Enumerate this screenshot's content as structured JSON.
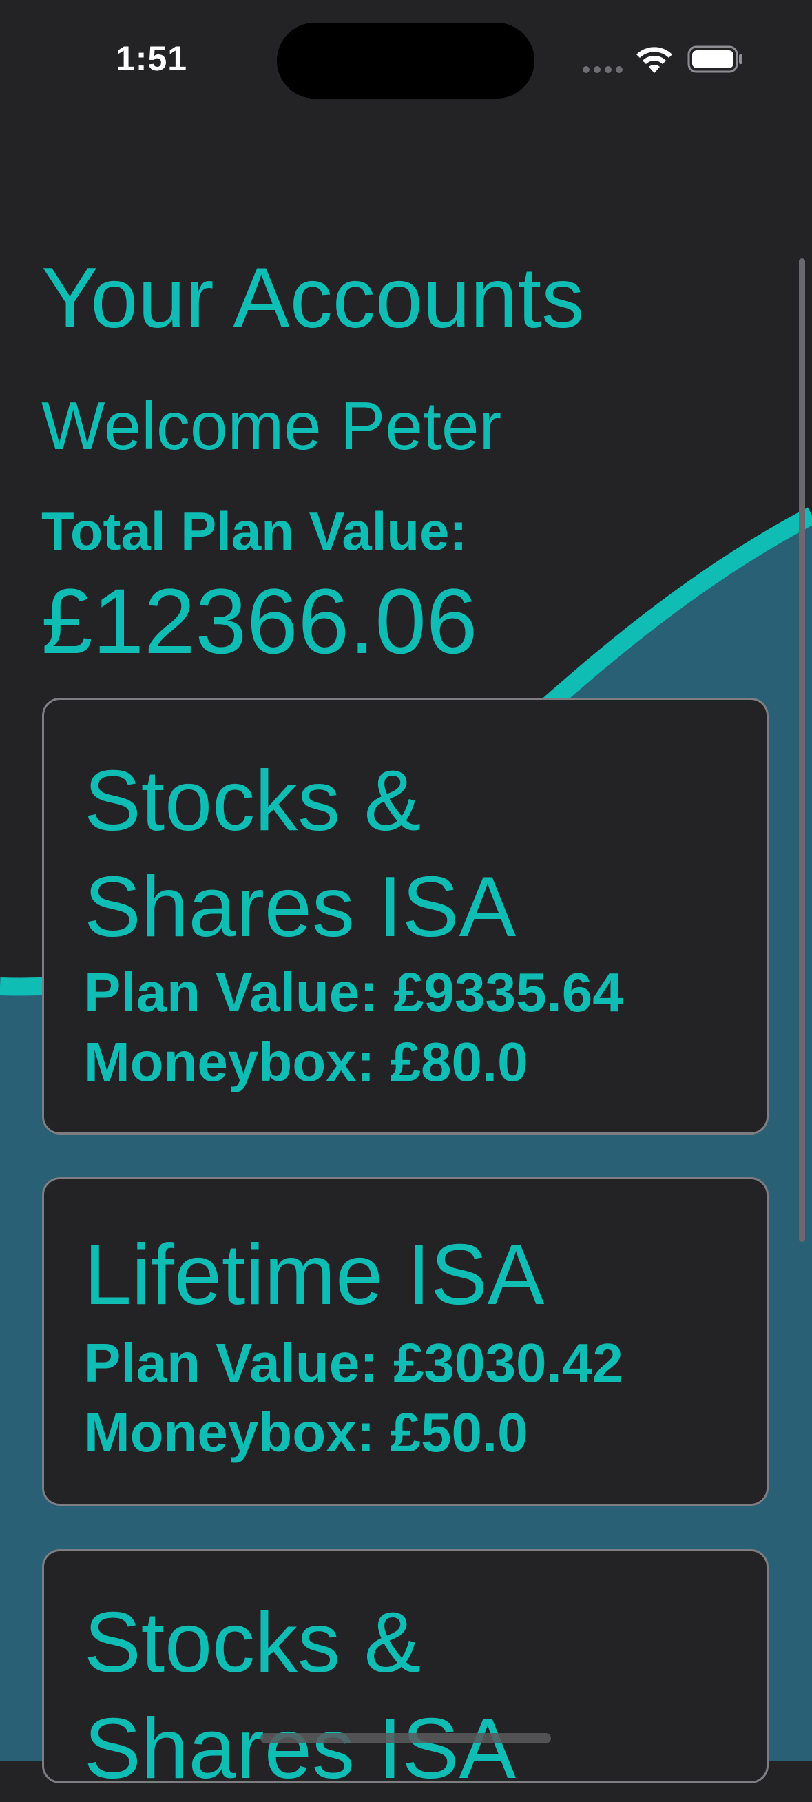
{
  "status_bar": {
    "time": "1:51"
  },
  "header": {
    "title": "Your Accounts",
    "welcome": "Welcome Peter",
    "total_label": "Total Plan Value:",
    "total_value": "£12366.06"
  },
  "accounts": [
    {
      "name": "Stocks & Shares ISA",
      "plan_value": "Plan Value: £9335.64",
      "moneybox": "Moneybox: £80.0"
    },
    {
      "name": "Lifetime ISA",
      "plan_value": "Plan Value: £3030.42",
      "moneybox": "Moneybox: £50.0"
    },
    {
      "name": "Stocks & Shares ISA"
    }
  ],
  "colors": {
    "background": "#232326",
    "accent": "#0fbdb4",
    "wave_fill": "#296076",
    "card_border": "#7e7e82"
  },
  "icons": {
    "signal": "cellular-signal-icon",
    "wifi": "wifi-icon",
    "battery": "battery-icon"
  }
}
